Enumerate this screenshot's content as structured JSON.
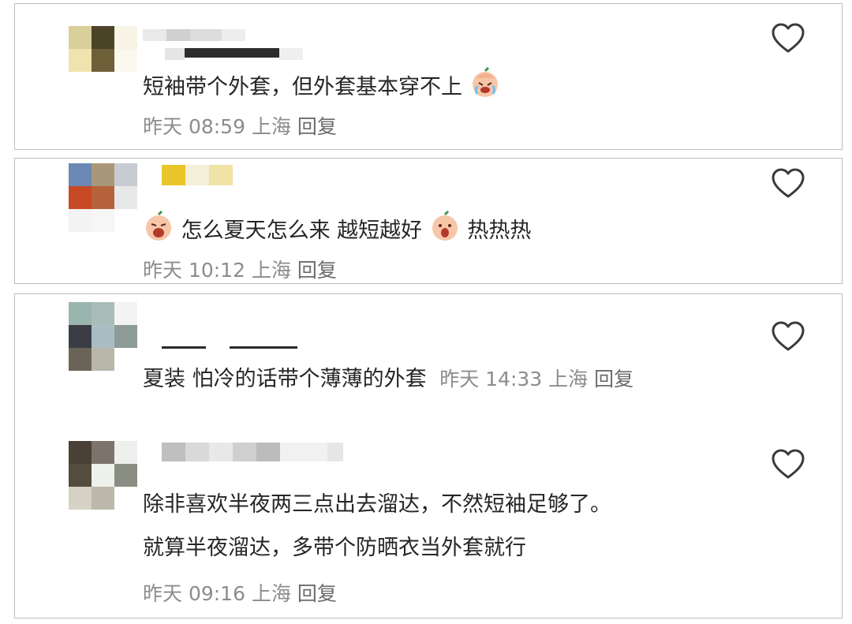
{
  "comments": [
    {
      "text": "短袖带个外套，但外套基本穿不上",
      "time": "昨天 08:59",
      "location": "上海",
      "reply": "回复",
      "emoji_after": "crying-laugh-emoji"
    },
    {
      "text_parts": [
        "怎么夏天怎么来 越短越好",
        "热热热"
      ],
      "time": "昨天 10:12",
      "location": "上海",
      "reply": "回复",
      "emoji_before": "shy-emoji",
      "emoji_middle": "hot-emoji"
    },
    {
      "text": "夏装  怕冷的话带个薄薄的外套",
      "time": "昨天 14:33",
      "location": "上海",
      "reply": "回复"
    },
    {
      "text_lines": [
        "除非喜欢半夜两三点出去溜达，不然短袖足够了。",
        "就算半夜溜达，多带个防晒衣当外套就行"
      ],
      "time": "昨天 09:16",
      "location": "上海",
      "reply": "回复"
    }
  ],
  "icons": {
    "like": "heart-outline-icon"
  },
  "colors": {
    "text": "#262626",
    "meta": "#8c8c8c",
    "border": "#bdbdbd"
  }
}
